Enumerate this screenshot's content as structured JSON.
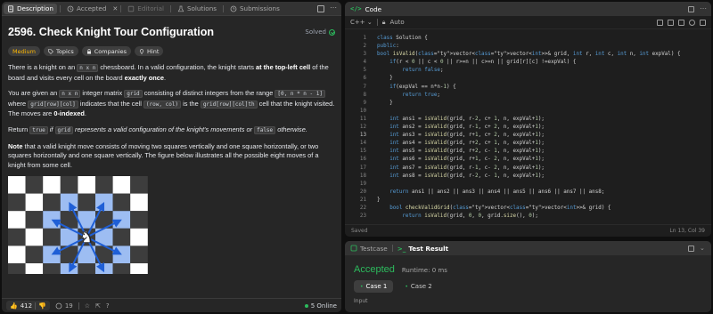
{
  "left_panel": {
    "tabs": [
      {
        "label": "Description",
        "icon": "document-icon",
        "active": true
      },
      {
        "label": "Accepted",
        "icon": "history-icon"
      },
      {
        "label": "Editorial",
        "icon": "book-icon",
        "dim": true
      },
      {
        "label": "Solutions",
        "icon": "flask-icon"
      },
      {
        "label": "Submissions",
        "icon": "clock-icon"
      }
    ],
    "title": "2596. Check Knight Tour Configuration",
    "status": "Solved",
    "chips": {
      "difficulty": "Medium",
      "topics": "Topics",
      "companies": "Companies",
      "hint": "Hint"
    },
    "description": {
      "p1_a": "There is a knight on an ",
      "p1_code": "n x n",
      "p1_b": " chessboard. In a valid configuration, the knight starts ",
      "p1_bold1": "at the top-left cell",
      "p1_c": " of the board and visits every cell on the board ",
      "p1_bold2": "exactly once",
      "p1_d": ".",
      "p2_a": "You are given an ",
      "p2_code1": "n x n",
      "p2_b": " integer matrix ",
      "p2_code2": "grid",
      "p2_c": " consisting of distinct integers from the range ",
      "p2_code3": "[0, n * n - 1]",
      "p2_d": " where ",
      "p2_code4": "grid[row][col]",
      "p2_e": " indicates that the cell ",
      "p2_code5": "(row, col)",
      "p2_f": " is the ",
      "p2_code6": "grid[row][col]th",
      "p2_g": " cell that the knight visited. The moves are ",
      "p2_bold": "0-indexed",
      "p2_h": ".",
      "p3_a": "Return ",
      "p3_code1": "true",
      "p3_b": " if ",
      "p3_code2": "grid",
      "p3_c": " represents a valid configuration of the knight's movements or ",
      "p3_code3": "false",
      "p3_d": " otherwise.",
      "p4_bold": "Note",
      "p4_text": " that a valid knight move consists of moving two squares vertically and one square horizontally, or two squares horizontally and one square vertically. The figure below illustrates all the possible eight moves of a knight from some cell."
    },
    "bottom_bar": {
      "likes": "412",
      "comments": "19",
      "online": "5 Online"
    }
  },
  "code_panel": {
    "title": "Code",
    "language": "C++",
    "auto_label": "Auto",
    "saved": "Saved",
    "cursor": "Ln 13, Col 39",
    "active_line": 13,
    "lines": [
      "class Solution {",
      "public:",
      "bool isValid(vector<vector<int>>& grid, int r, int c, int n, int expVal) {",
      "    if(r < 0 || c < 0 || r>=n || c>=n || grid[r][c] !=expVal) {",
      "        return false;",
      "    }",
      "    if(expVal == n*n-1) {",
      "        return true;",
      "    }",
      "",
      "    int ans1 = isValid(grid, r-2, c+ 1, n, expVal+1);",
      "    int ans2 = isValid(grid, r-1, c+ 2, n, expVal+1);",
      "    int ans3 = isValid(grid, r+1, c+ 2, n, expVal+1);",
      "    int ans4 = isValid(grid, r+2, c+ 1, n, expVal+1);",
      "    int ans5 = isValid(grid, r+2, c- 1, n, expVal+1);",
      "    int ans6 = isValid(grid, r+1, c- 2, n, expVal+1);",
      "    int ans7 = isValid(grid, r-1, c- 2, n, expVal+1);",
      "    int ans8 = isValid(grid, r-2, c- 1, n, expVal+1);",
      "",
      "    return ans1 || ans2 || ans3 || ans4 || ans5 || ans6 || ans7 || ans8;",
      "}",
      "    bool checkValidGrid(vector<vector<int>>& grid) {",
      "        return isValid(grid, 0, 0, grid.size(), 0);"
    ]
  },
  "test_panel": {
    "tab_testcase": "Testcase",
    "tab_result": "Test Result",
    "verdict": "Accepted",
    "runtime": "Runtime: 0 ms",
    "cases": [
      "Case 1",
      "Case 2"
    ],
    "input_label": "Input"
  },
  "colors": {
    "accent_green": "#2cbb5d",
    "medium": "#ffb800",
    "board_light": "#9dbdf2",
    "board_dark": "#3d3d3d"
  }
}
